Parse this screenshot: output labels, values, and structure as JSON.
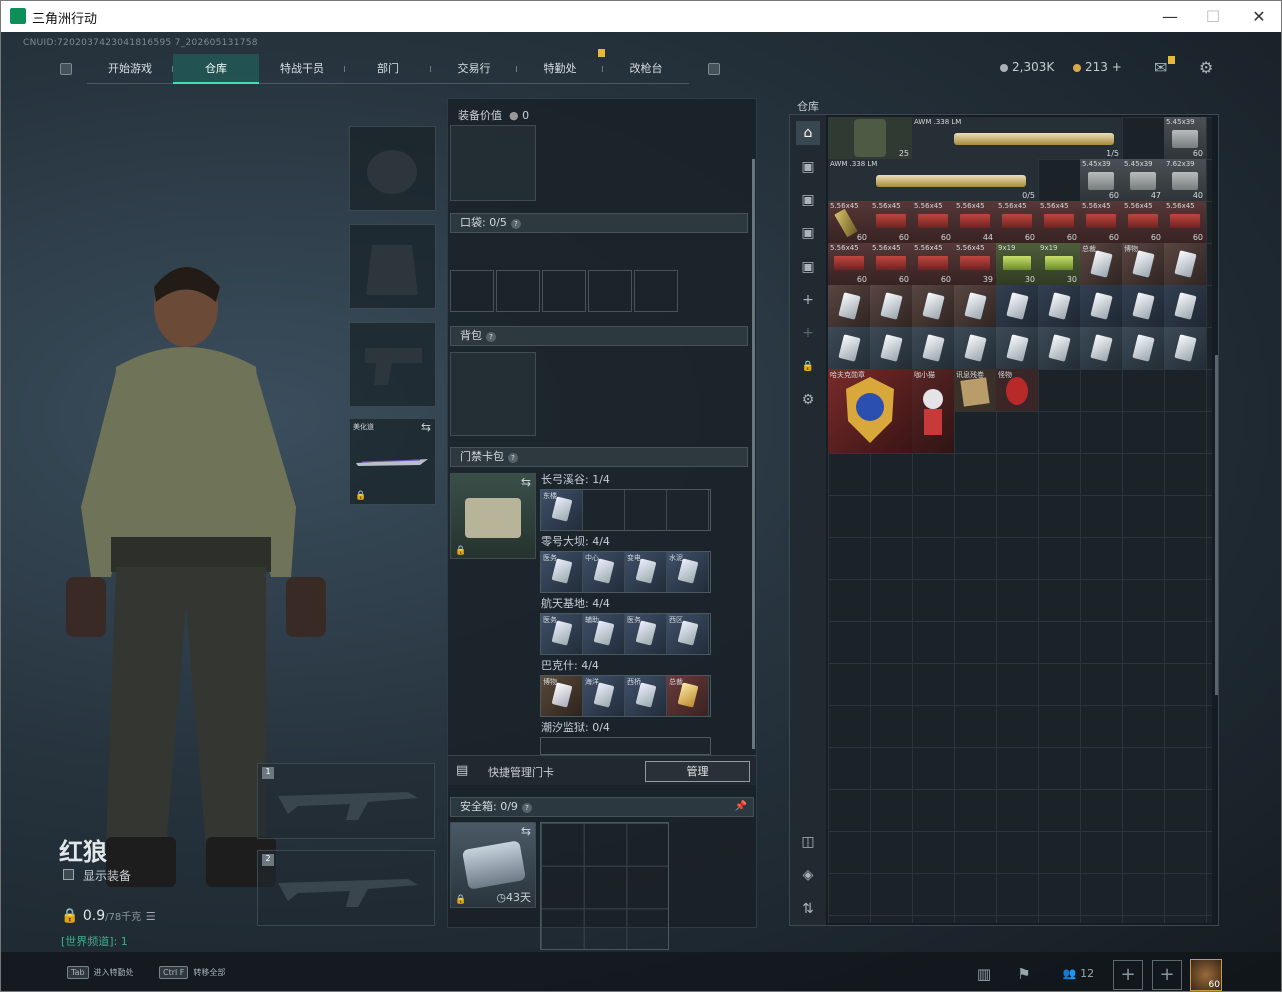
{
  "window": {
    "title": "三角洲行动"
  },
  "header": {
    "uid": "CNUID:7202037423041816595 7_202605131758",
    "tabs": [
      "开始游戏",
      "仓库",
      "特战干员",
      "部门",
      "交易行",
      "特勤处",
      "改枪台"
    ],
    "active_tab": "仓库",
    "currency_1": "2,303K",
    "currency_2": "213",
    "currency_plus": "+"
  },
  "character": {
    "name": "红狼",
    "show_equipment": "显示装备",
    "weight": "0.9",
    "weight_unit": "/78千克",
    "team_line": "[世界频道]: 1",
    "melee_slot_label": "美化道",
    "weapon_slot_1": "1",
    "weapon_slot_2": "2"
  },
  "loadout": {
    "value_label": "装备价值",
    "value": "0",
    "pocket_label": "口袋:",
    "pocket_count": "0/5",
    "backpack_label": "背包",
    "keycard_pack_label": "门禁卡包",
    "keycard_groups": [
      {
        "label": "长弓溪谷: 1/4",
        "slot_label": "东楼"
      },
      {
        "label": "零号大坝: 4/4",
        "slot_labels": [
          "医务",
          "中心",
          "变电",
          "水泥"
        ]
      },
      {
        "label": "航天基地: 4/4",
        "slot_labels": [
          "医务",
          "辅助",
          "医务",
          "西区"
        ]
      },
      {
        "label": "巴克什: 4/4",
        "slot_labels": [
          "博物",
          "海洋",
          "西桥",
          "总裁"
        ]
      },
      {
        "label": "潮汐监狱: 0/4"
      }
    ],
    "quick_manage_label": "快捷管理门卡",
    "manage_button": "管理",
    "safe_box_label": "安全箱:",
    "safe_box_count": "0/9",
    "safe_box_days": "43天"
  },
  "warehouse": {
    "title": "仓库",
    "items": [
      {
        "label": "",
        "count": "25"
      },
      {
        "label": "AWM .338 LM",
        "count": "1/5"
      },
      {
        "label": "5.45x39",
        "count": "60"
      },
      {
        "label": "AWM .338 LM",
        "count": "0/5"
      },
      {
        "label": "5.45x39",
        "count": "60"
      },
      {
        "label": "5.45x39",
        "count": "47"
      },
      {
        "label": "7.62x39",
        "count": "40"
      },
      {
        "label": "5.56x45",
        "count": "60"
      },
      {
        "label": "5.56x45",
        "count": "44"
      },
      {
        "label": "5.56x45",
        "count": "39"
      },
      {
        "label": "9x19",
        "count": "30"
      },
      {
        "label": "9x19",
        "count": ""
      },
      {
        "label": "总裁",
        "count": ""
      },
      {
        "label": "博物",
        "count": ""
      },
      {
        "label": "哈夫克勋章",
        "count": ""
      },
      {
        "label": "咖小猫",
        "count": ""
      },
      {
        "label": "讯息残卷",
        "count": ""
      },
      {
        "label": "怪物",
        "count": ""
      }
    ]
  },
  "bottom": {
    "hint_1_key": "Tab",
    "hint_1": "进入特勤处",
    "hint_2_key": "Ctrl F",
    "hint_2": "转移全部",
    "squad_count": "12",
    "level": "60"
  },
  "colors": {
    "accent": "#3fe0b5",
    "bg": "#1a232b"
  }
}
